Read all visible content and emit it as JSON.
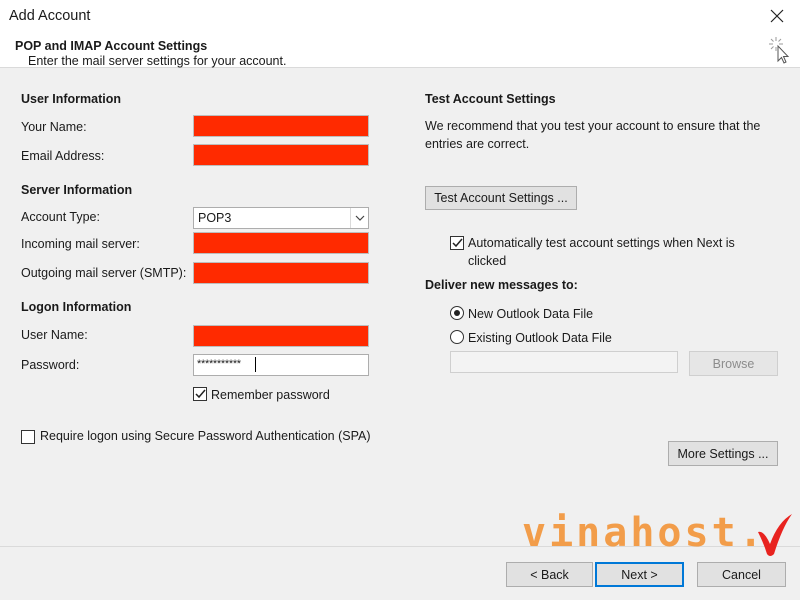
{
  "window": {
    "title": "Add Account"
  },
  "header": {
    "title": "POP and IMAP Account Settings",
    "subtitle": "Enter the mail server settings for your account."
  },
  "user_info": {
    "heading": "User Information",
    "your_name_label": "Your Name:",
    "email_label": "Email Address:"
  },
  "server_info": {
    "heading": "Server Information",
    "account_type_label": "Account Type:",
    "account_type_value": "POP3",
    "incoming_label": "Incoming mail server:",
    "outgoing_label": "Outgoing mail server (SMTP):"
  },
  "logon_info": {
    "heading": "Logon Information",
    "username_label": "User Name:",
    "password_label": "Password:",
    "password_value": "***********",
    "remember_label": "Remember password",
    "remember_checked": true,
    "spa_label": "Require logon using Secure Password Authentication (SPA)",
    "spa_checked": false
  },
  "test_settings": {
    "heading": "Test Account Settings",
    "description_line1": "We recommend that you test your account to ensure that the",
    "description_line2": "entries are correct.",
    "test_button": "Test Account Settings ...",
    "auto_test_line1": "Automatically test account settings when Next is",
    "auto_test_line2": "clicked",
    "auto_test_checked": true
  },
  "deliver": {
    "heading": "Deliver new messages to:",
    "new_file_label": "New Outlook Data File",
    "existing_file_label": "Existing Outlook Data File",
    "selected": "new",
    "browse_button": "Browse"
  },
  "more_settings_button": "More Settings ...",
  "footer": {
    "back_button": "< Back",
    "next_button": "Next >",
    "cancel_button": "Cancel"
  },
  "watermark": {
    "text": "vinahost."
  },
  "colors": {
    "redaction": "#ff2a00",
    "accent": "#0078d7",
    "watermark": "#f39234"
  }
}
